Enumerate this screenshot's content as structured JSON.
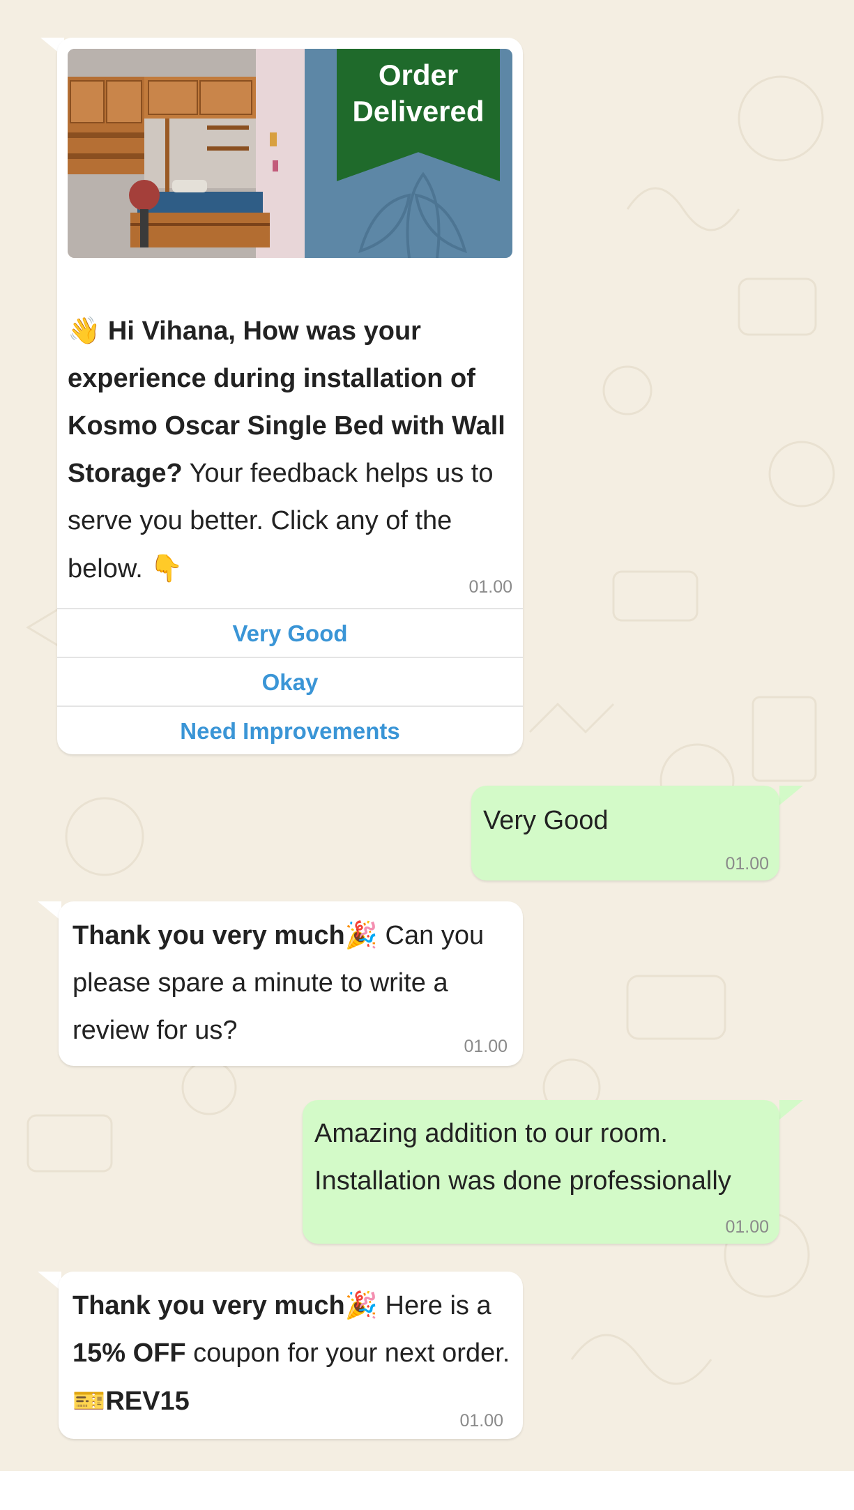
{
  "banner": {
    "ribbon_line1": "Order",
    "ribbon_line2": "Delivered"
  },
  "messages": {
    "m1": {
      "wave_emoji": "👋",
      "bold_text": "Hi Vihana, How was your experience during installation of Kosmo Oscar Single Bed with Wall Storage?",
      "text": " Your feedback helps us to serve you better. Click any of the below. ",
      "point_emoji": "👇",
      "time": "01.00",
      "buttons": [
        "Very Good",
        "Okay",
        "Need Improvements"
      ]
    },
    "m2": {
      "text": "Very Good",
      "time": "01.00"
    },
    "m3": {
      "bold_text": "Thank you very much",
      "emoji": "🎉",
      "text": " Can you please spare a minute to write a review for us?",
      "time": "01.00"
    },
    "m4": {
      "line1": "Amazing addition to our room.",
      "line2": "Installation was done professionally",
      "time": "01.00"
    },
    "m5": {
      "bold_text": "Thank you very much",
      "emoji": "🎉",
      "text1": " Here is a ",
      "bold_discount": "15% OFF",
      "text2": " coupon for your next order. ",
      "coupon_emoji": "🎫",
      "bold_code": "REV15",
      "time": "01.00"
    }
  },
  "colors": {
    "chat_background": "#f4eee2",
    "incoming_bubble": "#ffffff",
    "outgoing_bubble": "#d3fac8",
    "button_text": "#3a95d6",
    "ribbon": "#1f6a2b"
  }
}
